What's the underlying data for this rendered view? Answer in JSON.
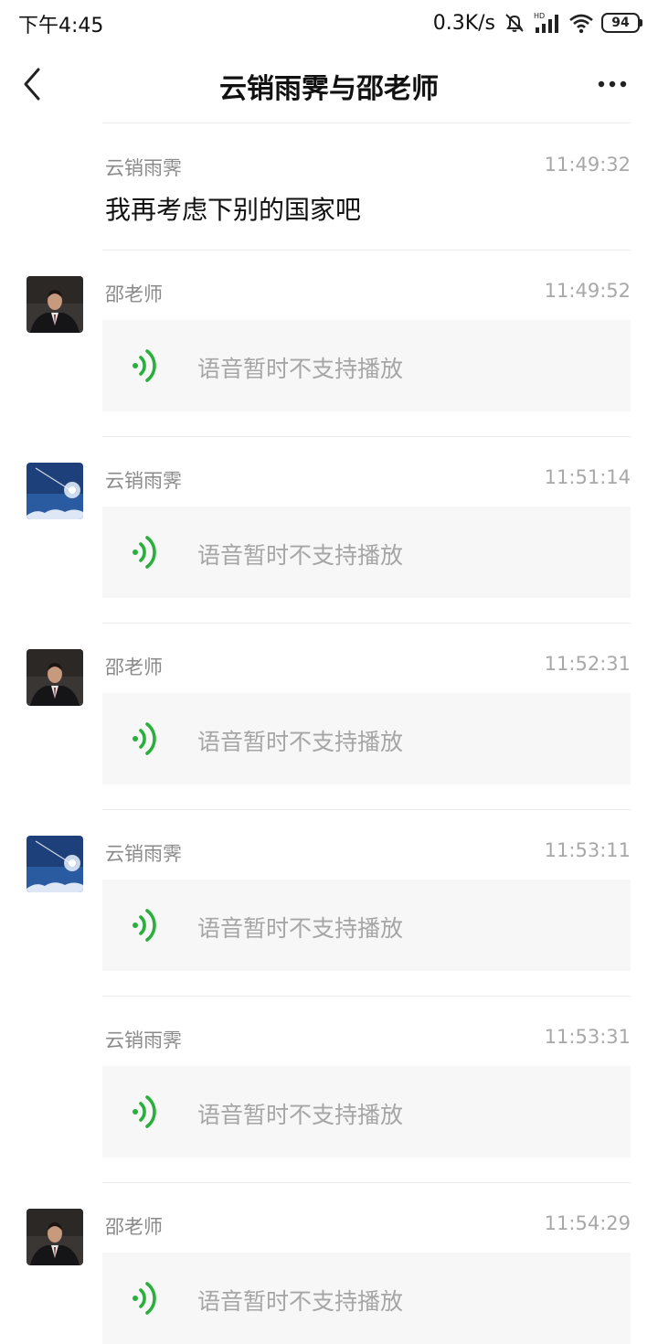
{
  "status_bar": {
    "time": "下午4:45",
    "net_speed": "0.3K/s",
    "battery": "94",
    "icons": [
      "bell-off-icon",
      "hd-signal-icon",
      "wifi-icon",
      "battery-icon"
    ]
  },
  "nav": {
    "title": "云销雨霁与邵老师",
    "back_icon": "chevron-left-icon",
    "more_icon": "more-dots-icon"
  },
  "colors": {
    "voice_green": "#2aae3c",
    "bubble_bg": "#f7f7f7"
  },
  "messages": [
    {
      "sender": "云销雨霁",
      "time": "11:49:32",
      "text": "我再考虑下别的国家吧",
      "avatar": "none"
    },
    {
      "sender": "邵老师",
      "time": "11:49:52",
      "voice_label": "语音暂时不支持播放",
      "avatar": "man-portrait"
    },
    {
      "sender": "云销雨霁",
      "time": "11:51:14",
      "voice_label": "语音暂时不支持播放",
      "avatar": "night-sky"
    },
    {
      "sender": "邵老师",
      "time": "11:52:31",
      "voice_label": "语音暂时不支持播放",
      "avatar": "man-portrait"
    },
    {
      "sender": "云销雨霁",
      "time": "11:53:11",
      "voice_label": "语音暂时不支持播放",
      "avatar": "night-sky"
    },
    {
      "sender": "云销雨霁",
      "time": "11:53:31",
      "voice_label": "语音暂时不支持播放",
      "avatar": "none"
    },
    {
      "sender": "邵老师",
      "time": "11:54:29",
      "voice_label": "语音暂时不支持播放",
      "avatar": "man-portrait"
    }
  ]
}
